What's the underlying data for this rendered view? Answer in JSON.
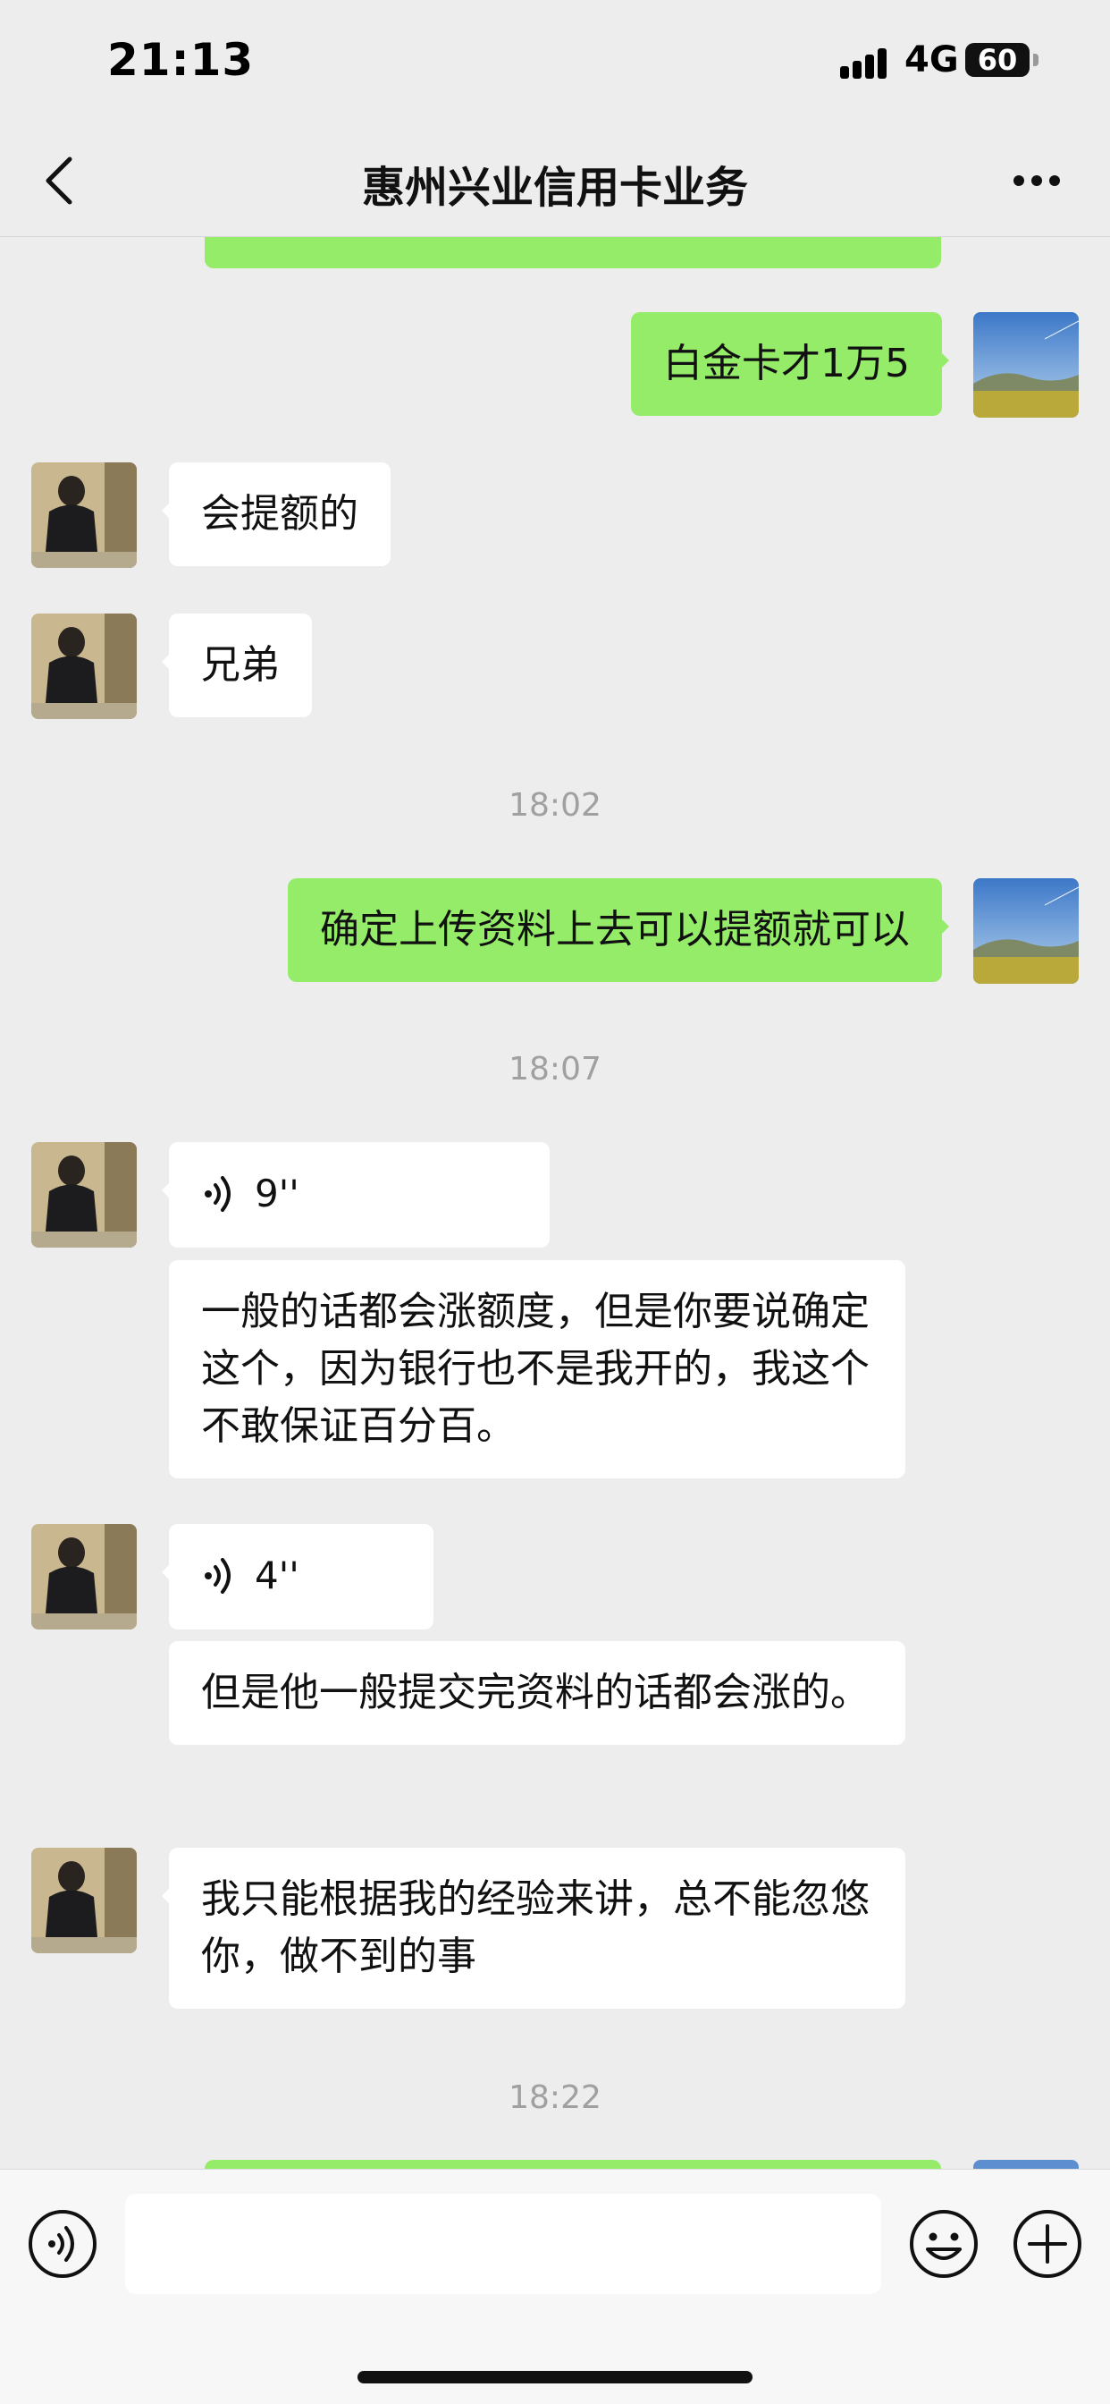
{
  "status_bar": {
    "time": "21:13",
    "network": "4G",
    "battery": "60"
  },
  "header": {
    "title": "惠州兴业信用卡业务"
  },
  "messages": {
    "m1": "白金卡才1万5",
    "m2": "会提额的",
    "m3": "兄弟",
    "t1": "18:02",
    "m4": "确定上传资料上去可以提额就可以",
    "t2": "18:07",
    "v1": "9''",
    "m5": "一般的话都会涨额度，但是你要说确定这个，因为银行也不是我开的，我这个不敢保证百分百。",
    "v2": "4''",
    "m6": "但是他一般提交完资料的话都会涨的。",
    "m7": "我只能根据我的经验来讲，总不能忽悠你，做不到的事",
    "t3": "18:22"
  },
  "colors": {
    "outgoing_bubble": "#95ec69",
    "incoming_bubble": "#ffffff",
    "background": "#ededed"
  },
  "icons": [
    "back-icon",
    "more-icon",
    "voice-input-icon",
    "emoji-icon",
    "plus-icon",
    "voice-wave-icon"
  ]
}
